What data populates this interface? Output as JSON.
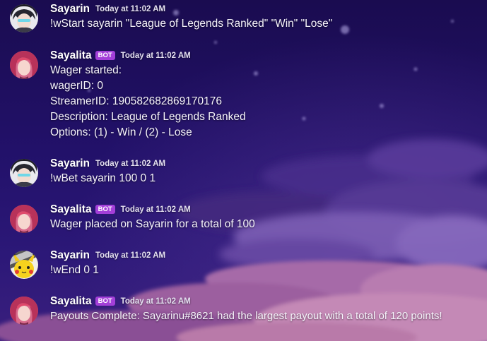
{
  "messages": [
    {
      "username": "Sayarin",
      "is_bot": false,
      "timestamp": "Today at 11:02 AM",
      "avatar_icon": "anime-character-avatar",
      "lines": [
        "!wStart sayarin \"League of Legends Ranked\" \"Win\" \"Lose\""
      ]
    },
    {
      "username": "Sayalita",
      "is_bot": true,
      "badge": "BOT",
      "timestamp": "Today at 11:02 AM",
      "avatar_icon": "red-hair-character-avatar",
      "lines": [
        "Wager started:",
        "wagerID: 0",
        "StreamerID: 190582682869170176",
        "Description: League of Legends Ranked",
        "Options: (1) - Win / (2) - Lose"
      ]
    },
    {
      "username": "Sayarin",
      "is_bot": false,
      "timestamp": "Today at 11:02 AM",
      "avatar_icon": "anime-character-avatar",
      "lines": [
        "!wBet sayarin 100 0 1"
      ]
    },
    {
      "username": "Sayalita",
      "is_bot": true,
      "badge": "BOT",
      "timestamp": "Today at 11:02 AM",
      "avatar_icon": "red-hair-character-avatar",
      "lines": [
        "Wager placed on Sayarin for a total of 100"
      ]
    },
    {
      "username": "Sayarin",
      "is_bot": false,
      "timestamp": "Today at 11:02 AM",
      "avatar_icon": "pikachu-avatar",
      "lines": [
        "!wEnd 0 1"
      ]
    },
    {
      "username": "Sayalita",
      "is_bot": true,
      "badge": "BOT",
      "timestamp": "Today at 11:02 AM",
      "avatar_icon": "red-hair-character-avatar",
      "lines": [
        "Payouts Complete: Sayarinu#8621 had the largest payout with a total of 120 points!"
      ]
    }
  ],
  "colors": {
    "bot_badge": "#a33fd8",
    "username": "#ffffff",
    "message_text": "#f6f4fb",
    "background_top": "#1d0d55",
    "background_bottom": "#6a3f8c"
  }
}
